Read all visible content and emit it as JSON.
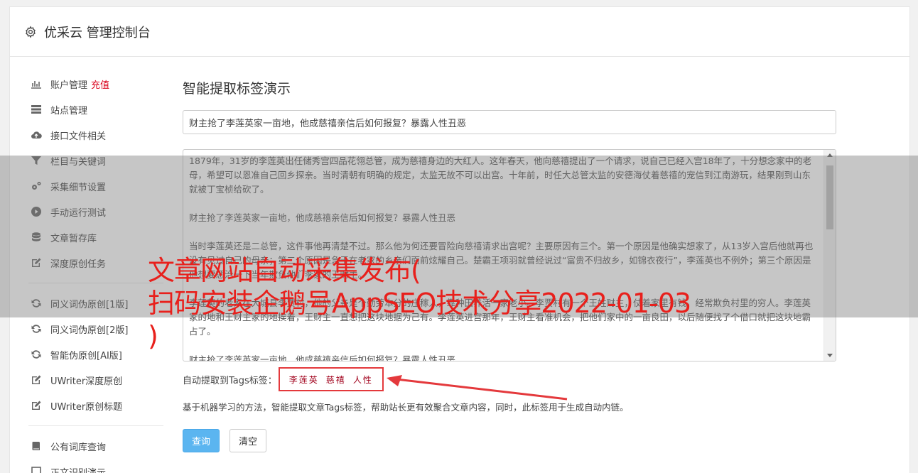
{
  "header": {
    "title": "优采云 管理控制台",
    "icon": "gear-icon"
  },
  "sidebar": {
    "group1": [
      {
        "label": "账户管理",
        "extra": "充值",
        "icon": "bar-chart-icon"
      },
      {
        "label": "站点管理",
        "icon": "server-icon"
      },
      {
        "label": "接口文件相关",
        "icon": "cloud-upload-icon"
      },
      {
        "label": "栏目与关键词",
        "icon": "filter-icon"
      },
      {
        "label": "采集细节设置",
        "icon": "gears-icon"
      },
      {
        "label": "手动运行测试",
        "icon": "play-icon"
      },
      {
        "label": "文章暂存库",
        "icon": "database-icon"
      },
      {
        "label": "深度原创任务",
        "icon": "edit-icon"
      }
    ],
    "group2": [
      {
        "label": "同义词伪原创[1版]",
        "icon": "refresh-icon"
      },
      {
        "label": "同义词伪原创[2版]",
        "icon": "refresh-icon"
      },
      {
        "label": "智能伪原创[AI版]",
        "icon": "refresh-icon"
      },
      {
        "label": "UWriter深度原创",
        "icon": "edit-icon"
      },
      {
        "label": "UWriter原创标题",
        "icon": "edit-icon"
      }
    ],
    "group3": [
      {
        "label": "公有词库查询",
        "icon": "book-icon"
      },
      {
        "label": "正文识别演示",
        "icon": "square-icon"
      }
    ]
  },
  "main": {
    "heading": "智能提取标签演示",
    "title_value": "财主抢了李莲英家一亩地，他成慈禧亲信后如何报复？暴露人性丑恶",
    "content_paragraphs": [
      "1879年，31岁的李莲英出任储秀宫四品花翎总管，成为慈禧身边的大红人。这年春天，他向慈禧提出了一个请求，说自己已经入宫18年了，十分想念家中的老母，希望可以恩准自己回乡探亲。当时清朝有明确的规定，太监无故不可以出宫。十年前，时任大总管太监的安德海仗着慈禧的宠信到江南游玩，结果刚到山东就被丁宝桢给砍了。",
      "财主抢了李莲英家一亩地，他成慈禧亲信后如何报复？暴露人性丑恶",
      "当时李莲英还是二总管，这件事他再清楚不过。那么他为何还要冒险向慈禧请求出宫呢？主要原因有三个。第一个原因是他确实想家了，从13岁入宫后他就再也没有见过自己的母亲；第二个原因是急于在老家的乡亲们面前炫耀自己。楚霸王项羽就曾经说过“富贵不归故乡，如锦衣夜行”，李莲英也不例外；第三个原因是他想要惩治一下当年欺负他们李家的王财主。",
      "李莲英的老家在大城县李贾村，他的父亲是个勤劳本分的庄稼人，靠种田养活一家老小。李贾村有一个王姓财主，仗着家里有钱，经常欺负村里的穷人。李莲英家的地和王财主家的地挨着，王财主一直想把这块地据为己有。李莲英进宫那年，王财主看准机会，把他们家中的一亩良田，以后随便找了个借口就把这块地霸占了。",
      "财主抢了李莲英家一亩地，他成慈禧亲信后如何报复？暴露人性丑恶"
    ],
    "tags_label": "自动提取到Tags标签：",
    "tags": [
      "李莲英",
      "慈禧",
      "人性"
    ],
    "description": "基于机器学习的方法，智能提取文章Tags标签，帮助站长更有效聚合文章内容，同时，此标签用于生成自动内链。",
    "query_button": "查询",
    "clear_button": "清空"
  },
  "overlay": {
    "line1": "文章网站自动采集发布(",
    "line2": "扫码安装企鹅号AppSEO技术分享2022-01-03",
    "line3": ")"
  }
}
